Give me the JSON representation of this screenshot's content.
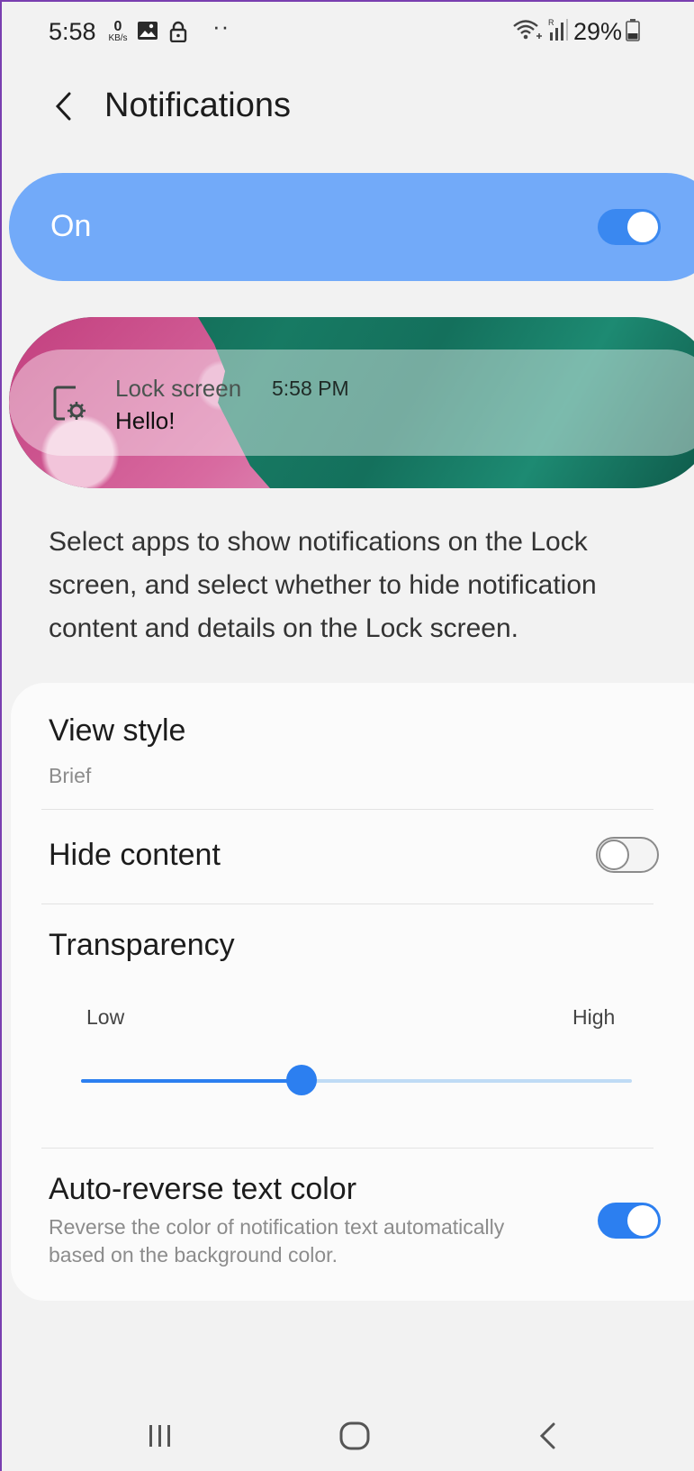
{
  "status_bar": {
    "time": "5:58",
    "speed_value": "0",
    "speed_unit": "KB/s",
    "battery": "29%",
    "icons": [
      "image-icon",
      "lock-icon",
      "more-dots-icon",
      "wifi-icon",
      "signal-icon",
      "battery-icon"
    ]
  },
  "header": {
    "title": "Notifications",
    "back_icon": "back-arrow-icon"
  },
  "master_switch": {
    "label": "On",
    "enabled": true
  },
  "preview": {
    "app_name": "Lock screen",
    "time": "5:58 PM",
    "message": "Hello!",
    "icon": "settings-app-icon"
  },
  "description": "Select apps to show notifications on the Lock screen, and select whether to hide notification content and details on the Lock screen.",
  "settings": {
    "view_style": {
      "title": "View style",
      "value": "Brief"
    },
    "hide_content": {
      "title": "Hide content",
      "enabled": false
    },
    "transparency": {
      "title": "Transparency",
      "low_label": "Low",
      "high_label": "High",
      "level": 0.4
    },
    "auto_reverse": {
      "title": "Auto-reverse text color",
      "description": "Reverse the color of notification text automatically based on the background color.",
      "enabled": true
    }
  },
  "nav_bar": {
    "icons": [
      "recents-icon",
      "home-icon",
      "back-icon"
    ]
  },
  "colors": {
    "accent": "#2c7ff0",
    "master_bar": "#72aaf9",
    "background": "#f2f2f2"
  }
}
